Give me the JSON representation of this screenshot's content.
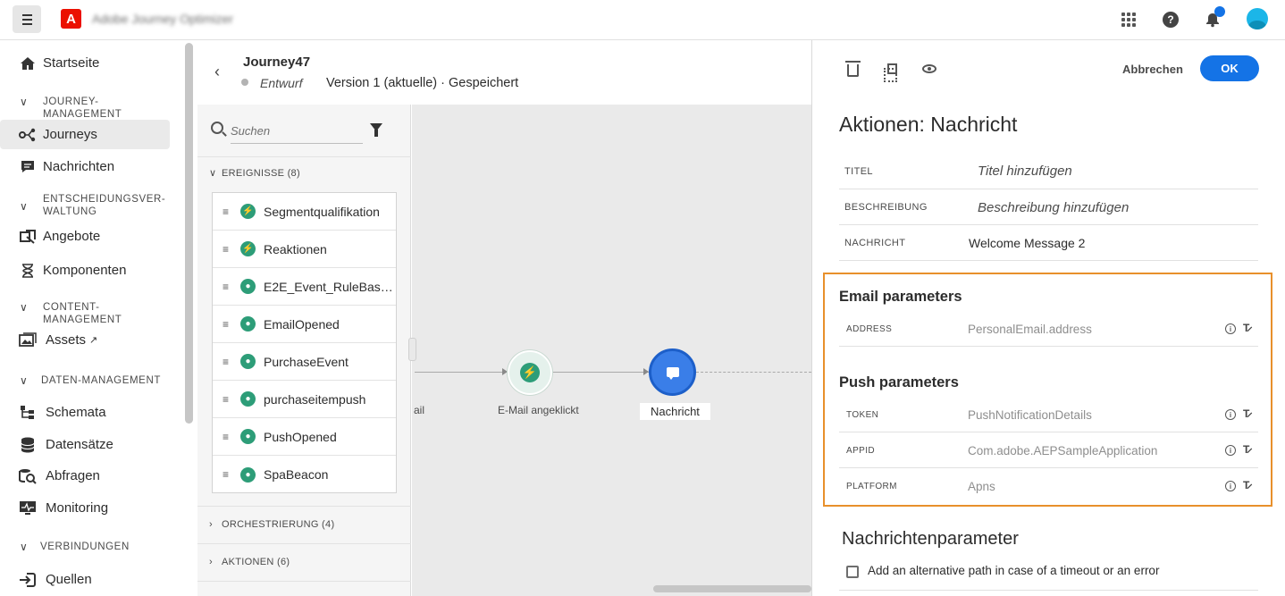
{
  "topbar": {
    "app_name": "Adobe Journey Optimizer",
    "icons": [
      "menu-icon",
      "adobe-logo",
      "apps-grid-icon",
      "help-icon",
      "bell-icon",
      "avatar"
    ]
  },
  "sidebar": {
    "home": "Startseite",
    "sec_journey": "Journey- Management",
    "journeys": "Journeys",
    "messages": "Nachrichten",
    "sec_decision": "Entscheidungsver-waltung",
    "offers": "Angebote",
    "components": "Komponenten",
    "sec_content": "Content- Management",
    "assets": "Assets",
    "sec_data": "Daten-Management",
    "schemas": "Schemata",
    "datasets": "Datensätze",
    "queries": "Abfragen",
    "monitoring": "Monitoring",
    "sec_connections": "Verbindungen",
    "sources": "Quellen"
  },
  "journey": {
    "name": "Journey47",
    "status": "Entwurf",
    "version": "Version 1 (aktuelle) · Gespeichert"
  },
  "palette": {
    "search_placeholder": "Suchen",
    "events_header": "Ereignisse (8)",
    "events": [
      {
        "label": "Segmentqualifikation",
        "type": "lightning"
      },
      {
        "label": "Reaktionen",
        "type": "lightning"
      },
      {
        "label": "E2E_Event_RuleBased...",
        "type": "globe"
      },
      {
        "label": "EmailOpened",
        "type": "globe"
      },
      {
        "label": "PurchaseEvent",
        "type": "globe"
      },
      {
        "label": "purchaseitempush",
        "type": "globe"
      },
      {
        "label": "PushOpened",
        "type": "globe"
      },
      {
        "label": "SpaBeacon",
        "type": "globe"
      }
    ],
    "orchestration_header": "Orchestrierung (4)",
    "actions_header": "Aktionen (6)"
  },
  "canvas": {
    "left_label": "ail",
    "event_node_label": "E-Mail angeklickt",
    "message_node_label": "Nachricht"
  },
  "panel": {
    "cancel_label": "Abbrechen",
    "ok_label": "OK",
    "title": "Aktionen: Nachricht",
    "props": [
      {
        "key": "TITEL",
        "value": "Titel hinzufügen"
      },
      {
        "key": "BESCHREIBUNG",
        "value": "Beschreibung hinzufügen"
      },
      {
        "key": "NACHRICHT",
        "value": "Welcome Message 2"
      }
    ],
    "email_params_title": "Email parameters",
    "email_params": [
      {
        "key": "ADDRESS",
        "value": "PersonalEmail.address"
      }
    ],
    "push_params_title": "Push parameters",
    "push_params": [
      {
        "key": "TOKEN",
        "value": "PushNotificationDetails"
      },
      {
        "key": "APPID",
        "value": "Com.adobe.AEPSampleApplication"
      },
      {
        "key": "PLATFORM",
        "value": "Apns"
      }
    ],
    "message_params_title": "Nachrichtenparameter",
    "alt_path_label": "Add an alternative path in case of a timeout or an error"
  },
  "colors": {
    "accent": "#1473e6",
    "highlight_border": "#e8902b",
    "event_green": "#2d9d78",
    "adobe_red": "#eb1000"
  }
}
